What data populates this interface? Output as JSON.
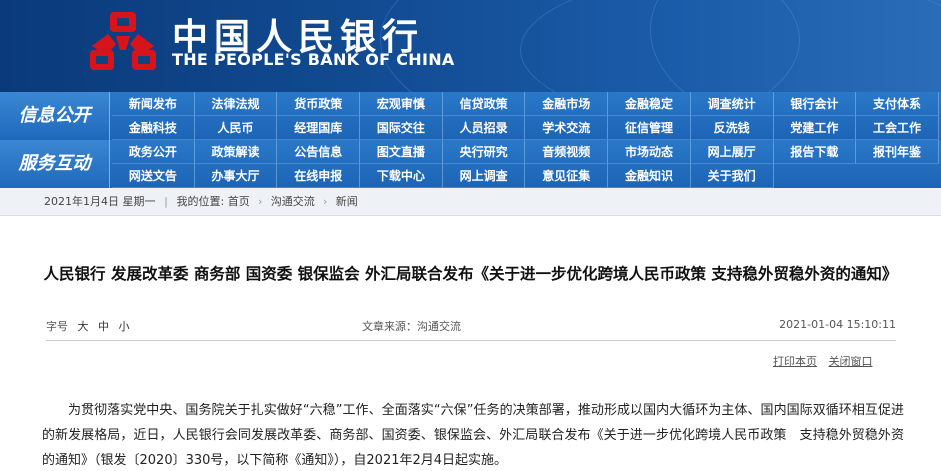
{
  "header": {
    "title_cn": "中国人民银行",
    "title_en": "THE PEOPLE'S BANK OF CHINA"
  },
  "nav": {
    "section1": {
      "label": "信息公开",
      "row1": [
        "新闻发布",
        "法律法规",
        "货币政策",
        "宏观审慎",
        "信贷政策",
        "金融市场",
        "金融稳定",
        "调查统计",
        "银行会计",
        "支付体系"
      ],
      "row2": [
        "金融科技",
        "人民币",
        "经理国库",
        "国际交往",
        "人员招录",
        "学术交流",
        "征信管理",
        "反洗钱",
        "党建工作",
        "工会工作"
      ]
    },
    "section2": {
      "label": "服务互动",
      "row1": [
        "政务公开",
        "政策解读",
        "公告信息",
        "图文直播",
        "央行研究",
        "音频视频",
        "市场动态",
        "网上展厅",
        "报告下载",
        "报刊年鉴"
      ],
      "row2": [
        "网送文告",
        "办事大厅",
        "在线申报",
        "下载中心",
        "网上调查",
        "意见征集",
        "金融知识",
        "关于我们"
      ]
    }
  },
  "breadcrumb": {
    "date": "2021年1月4日 星期一",
    "location_label": "我的位置:",
    "home": "首页",
    "level1": "沟通交流",
    "level2": "新闻"
  },
  "article": {
    "title": "人民银行 发展改革委 商务部 国资委 银保监会 外汇局联合发布《关于进一步优化跨境人民币政策 支持稳外贸稳外资的通知》",
    "font_size_label": "字号",
    "font_large": "大",
    "font_medium": "中",
    "font_small": "小",
    "source": "文章来源：沟通交流",
    "datetime": "2021-01-04 15:10:11",
    "print_label": "打印本页",
    "close_label": "关闭窗口",
    "body": "为贯彻落实党中央、国务院关于扎实做好“六稳”工作、全面落实“六保”任务的决策部署，推动形成以国内大循环为主体、国内国际双循环相互促进的新发展格局，近日，人民银行会同发展改革委、商务部、国资委、银保监会、外汇局联合发布《关于进一步优化跨境人民币政策　支持稳外贸稳外资的通知》（银发〔2020〕330号，以下简称《通知》），自2021年2月4日起实施。"
  }
}
